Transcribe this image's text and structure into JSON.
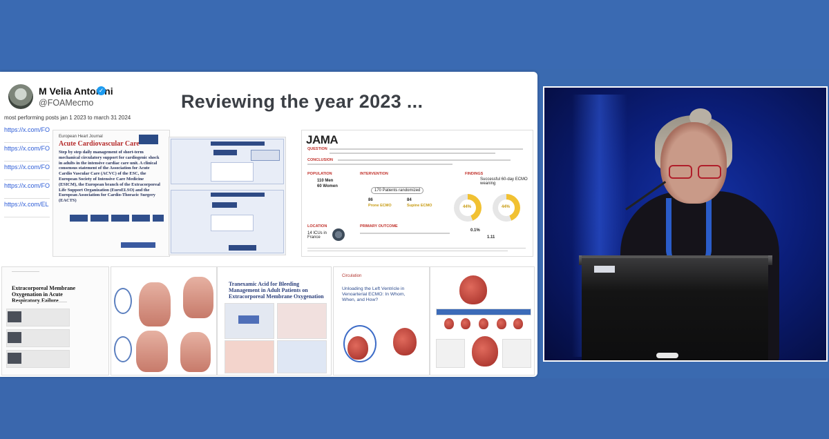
{
  "slide": {
    "author_name": "M Velia Antonini",
    "author_handle": "@FOAMecmo",
    "posts_caption": "most performing posts jan 1 2023 to march 31 2024",
    "links": [
      "https://x.com/FOAM",
      "https://x.com/FOAM",
      "https://x.com/FOAM",
      "https://x.com/FOAM",
      "https://x.com/EL SO"
    ],
    "title": "Reviewing the year 2023 ..."
  },
  "thumbnails": {
    "ehj": {
      "journal": "European Heart Journal",
      "title": "Acute Cardiovascular Care",
      "body": "Step by step daily management of short-term mechanical circulatory support for cardiogenic shock in adults in the intensive cardiac care unit. A clinical consensus statement of the Association for Acute Cardio Vascular Care (ACVC) of the ESC, the European Society of Intensive Care Medicine (ESICM), the European branch of the Extracorporeal Life Support Organization (EuroELSO) and the European Association for Cardio-Thoracic Surgery (EACTS)"
    },
    "jama": {
      "logo": "JAMA",
      "question_label": "QUESTION",
      "conclusion_label": "CONCLUSION",
      "population_label": "POPULATION",
      "population_men": "110 Men",
      "population_women": "60 Women",
      "intervention_label": "INTERVENTION",
      "randomized": "170 Patients randomized",
      "prone_n": "86",
      "prone_label": "Prone ECMO",
      "supine_n": "84",
      "supine_label": "Supine ECMO",
      "findings_label": "FINDINGS",
      "findings_text": "Successful 60-day ECMO weaning",
      "prone_pct": "44%",
      "supine_pct": "44%",
      "location_label": "LOCATION",
      "location_text": "14 ICUs in France",
      "outcome_label": "PRIMARY OUTCOME",
      "risk_diff": "0.1%",
      "subdist_ratio": "1.11"
    },
    "paper_a_title": "Extracorporeal Membrane Oxygenation in Acute Respiratory Failure",
    "paper_b_title": "Tranexamic Acid for Bleeding Management in Adult Patients on Extracorporeal Membrane Oxygenation",
    "paper_c_journal": "Circulation",
    "paper_c_title": "Unloading the Left Ventricle in Venoarterial ECMO: In Whom, When, and How?"
  },
  "colors": {
    "background": "#3a6ab0",
    "slide_title": "#3b3f45",
    "link": "#2b5bd7",
    "ehj_red": "#b52a2a",
    "jama_red": "#c0302a",
    "verified": "#1d9bf0"
  },
  "icons": [
    "verified-badge-icon",
    "globe-icon"
  ]
}
